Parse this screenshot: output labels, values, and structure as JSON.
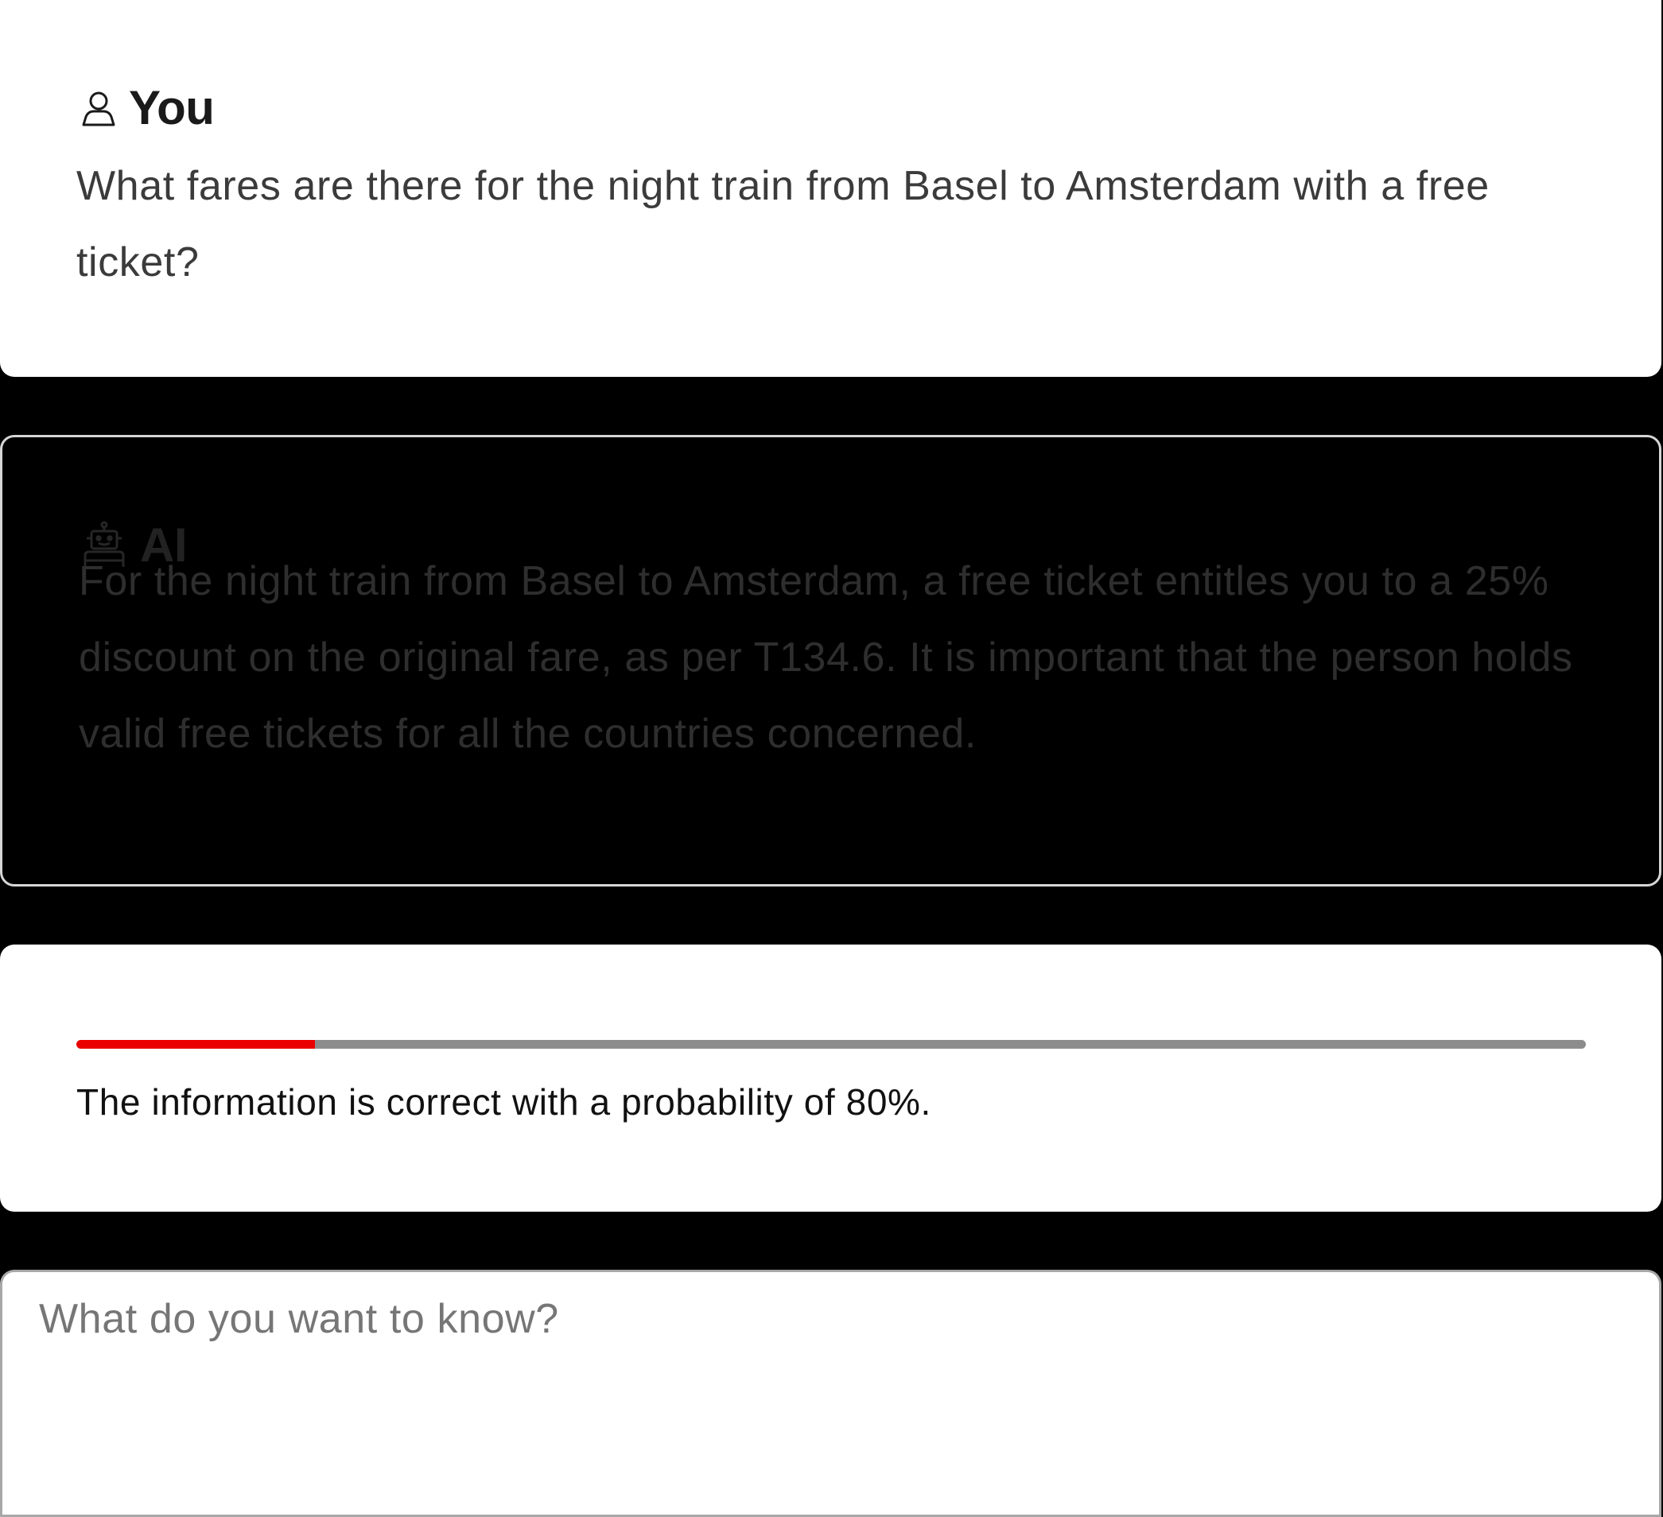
{
  "conversation": {
    "user_message": {
      "author": "You",
      "icon": "user-icon",
      "text": "What fares are there for the night train from Basel to Amsterdam with a free ticket?"
    },
    "ai_message": {
      "author": "AI",
      "icon": "robot-icon",
      "text": "For the night train from Basel to Amsterdam, a free ticket entitles you to a 25% discount on the original fare, as per T134.6. It is important that the person holds valid free tickets for all the countries concerned."
    }
  },
  "confidence": {
    "probability_percent": 80,
    "bar_fill_fraction": 0.158,
    "text": "The information is correct with a probability of 80%.",
    "colors": {
      "fill": "#eb0000",
      "track": "#8c8c8c"
    }
  },
  "composer": {
    "value": "",
    "placeholder": "What do you want to know?"
  }
}
